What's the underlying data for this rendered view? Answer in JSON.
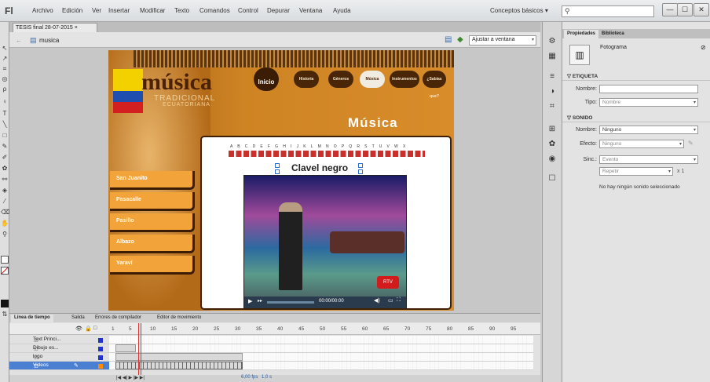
{
  "app": {
    "logo": "Fl",
    "workspace": "Conceptos básicos ▾",
    "search_placeholder": ""
  },
  "menu": [
    "Archivo",
    "Edición",
    "Ver",
    "Insertar",
    "Modificar",
    "Texto",
    "Comandos",
    "Control",
    "Depurar",
    "Ventana",
    "Ayuda"
  ],
  "window_buttons": [
    "—",
    "☐",
    "✕"
  ],
  "doc": {
    "tab": "TESIS final 28-07-2015 ×",
    "scene": "musica",
    "zoom": "Ajustar a ventana"
  },
  "stage": {
    "brand": "música",
    "brand_sub1": "TRADICIONAL",
    "brand_sub2": "ECUATORIANA",
    "home": "Inicio",
    "nav": [
      "Historia",
      "Géneros",
      "Música",
      "Instrumentos",
      "¿Sabías que?"
    ],
    "heading": "Música",
    "alphabet": "A B C D E F G H I J K L M N O P Q R S T U V W X",
    "song_title": "Clavel negro",
    "side_menu": [
      "San Juanito",
      "Pasacalle",
      "Pasillo",
      "Albazo",
      "Yaraví"
    ],
    "video_time": "00:00/00:00",
    "video_logo": "RTV"
  },
  "timeline": {
    "tabs": [
      "Línea de tiempo",
      "Salida",
      "Errores de compilador",
      "Editor de movimiento"
    ],
    "frame_numbers": [
      "1",
      "5",
      "10",
      "15",
      "20",
      "25",
      "30",
      "35",
      "40",
      "45",
      "50",
      "55",
      "60",
      "65",
      "70",
      "75",
      "80",
      "85",
      "90",
      "95"
    ],
    "layers": [
      {
        "name": "Text Princi...",
        "color": "#2233cc"
      },
      {
        "name": "Dibujo es...",
        "color": "#2233cc"
      },
      {
        "name": "logo",
        "color": "#2233cc"
      },
      {
        "name": "Videos",
        "color": "#ff8a00",
        "selected": true
      }
    ],
    "fps": "6,00 fps",
    "elapsed": "1,0 s"
  },
  "properties": {
    "tabs": [
      "Propiedades",
      "Biblioteca"
    ],
    "type": "Fotograma",
    "etiqueta_header": "ETIQUETA",
    "nombre_label": "Nombre:",
    "nombre_value": "",
    "tipo_label": "Tipo:",
    "tipo_value": "Nombre",
    "sonido_header": "SONIDO",
    "sonido_nombre_label": "Nombre:",
    "sonido_nombre_value": "Ninguno",
    "efecto_label": "Efecto:",
    "efecto_value": "Ninguno",
    "sinc_label": "Sinc.:",
    "sinc_value": "Evento",
    "repetir_value": "Repetir",
    "repeat_count": "x 1",
    "no_sound_msg": "No hay ningún sonido seleccionado"
  }
}
